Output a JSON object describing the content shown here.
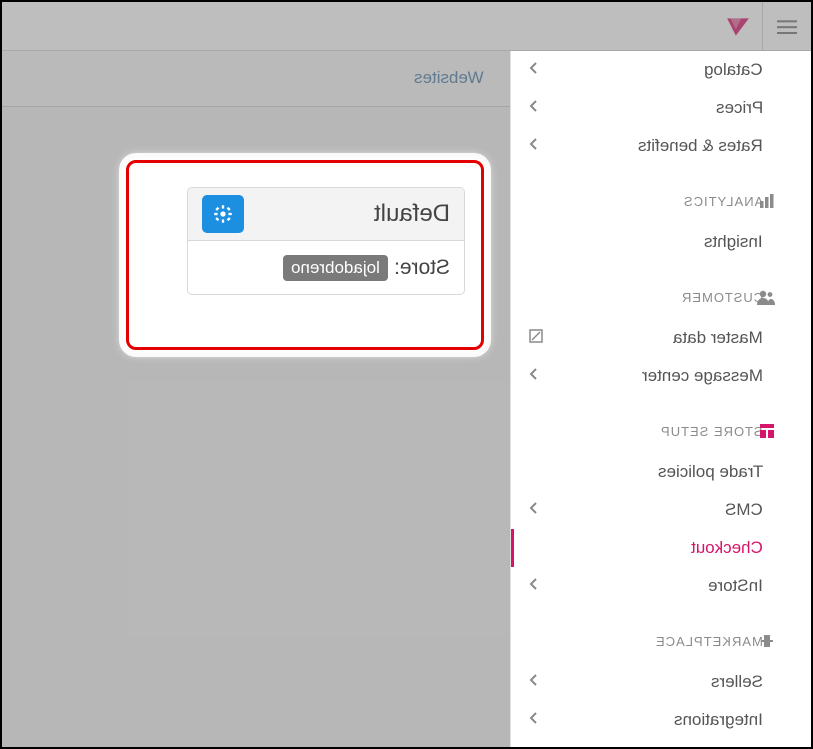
{
  "topbar": {
    "logo_color": "#d6146a"
  },
  "sidebar": {
    "items_top": [
      {
        "label": "Catalog",
        "chev": true
      },
      {
        "label": "Prices",
        "chev": true
      },
      {
        "label": "Rates & benefits",
        "chev": true
      }
    ],
    "section_analytics": "ANALYTICS",
    "items_analytics": [
      {
        "label": "Insights",
        "chev": false
      }
    ],
    "section_customer": "CUSTOMER",
    "items_customer": [
      {
        "label": "Master data",
        "extra": "newtab"
      },
      {
        "label": "Message center",
        "chev": true
      }
    ],
    "section_store": "STORE SETUP",
    "items_store": [
      {
        "label": "Trade policies",
        "chev": false
      },
      {
        "label": "CMS",
        "chev": true
      },
      {
        "label": "Checkout",
        "active": true
      },
      {
        "label": "InStore",
        "chev": true
      }
    ],
    "section_marketplace": "MARKETPLACE",
    "items_marketplace": [
      {
        "label": "Sellers",
        "chev": true
      },
      {
        "label": "Integrations",
        "chev": true
      }
    ]
  },
  "content": {
    "tab_websites": "Websites"
  },
  "card": {
    "title": "Default",
    "store_label": "Store:",
    "store_value": "lojadobreno"
  }
}
